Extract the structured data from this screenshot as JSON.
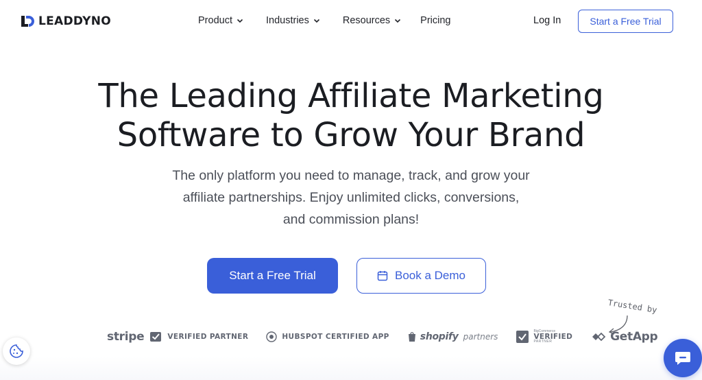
{
  "brand": {
    "name": "LEADDYNO",
    "accent": "#3a5fd9",
    "text": "#1b1d22"
  },
  "nav": {
    "items": [
      {
        "label": "Product",
        "has_dropdown": true,
        "icon": "chevron-down-icon"
      },
      {
        "label": "Industries",
        "has_dropdown": true,
        "icon": "chevron-down-icon"
      },
      {
        "label": "Resources",
        "has_dropdown": true,
        "icon": "chevron-down-icon"
      },
      {
        "label": "Pricing",
        "has_dropdown": false
      }
    ],
    "login_label": "Log In",
    "cta_label": "Start a Free Trial"
  },
  "hero": {
    "title_line1": "The Leading Affiliate Marketing",
    "title_line2": "Software to Grow Your Brand",
    "sub_line1": "The only platform you need to manage, track, and grow your",
    "sub_line2": "affiliate partnerships. Enjoy unlimited clicks, conversions,",
    "sub_line3": "and commission plans!",
    "primary_cta": "Start a Free Trial",
    "secondary_cta": "Book a Demo",
    "secondary_icon": "calendar-icon"
  },
  "trusted": {
    "label": "Trusted by",
    "partners": {
      "stripe_word": "stripe",
      "stripe_badge": "VERIFIED PARTNER",
      "hubspot": "HUBSPOT CERTIFIED APP",
      "shopify_word": "shopify",
      "shopify_partners": "partners",
      "bigcommerce_small": "BigCommerce",
      "bigcommerce_verified": "VERIFIED",
      "bigcommerce_partner": "PARTNER",
      "getapp": "GetApp"
    }
  },
  "widgets": {
    "cookie_icon": "cookie-icon",
    "chat_icon": "chat-bubble-icon"
  }
}
